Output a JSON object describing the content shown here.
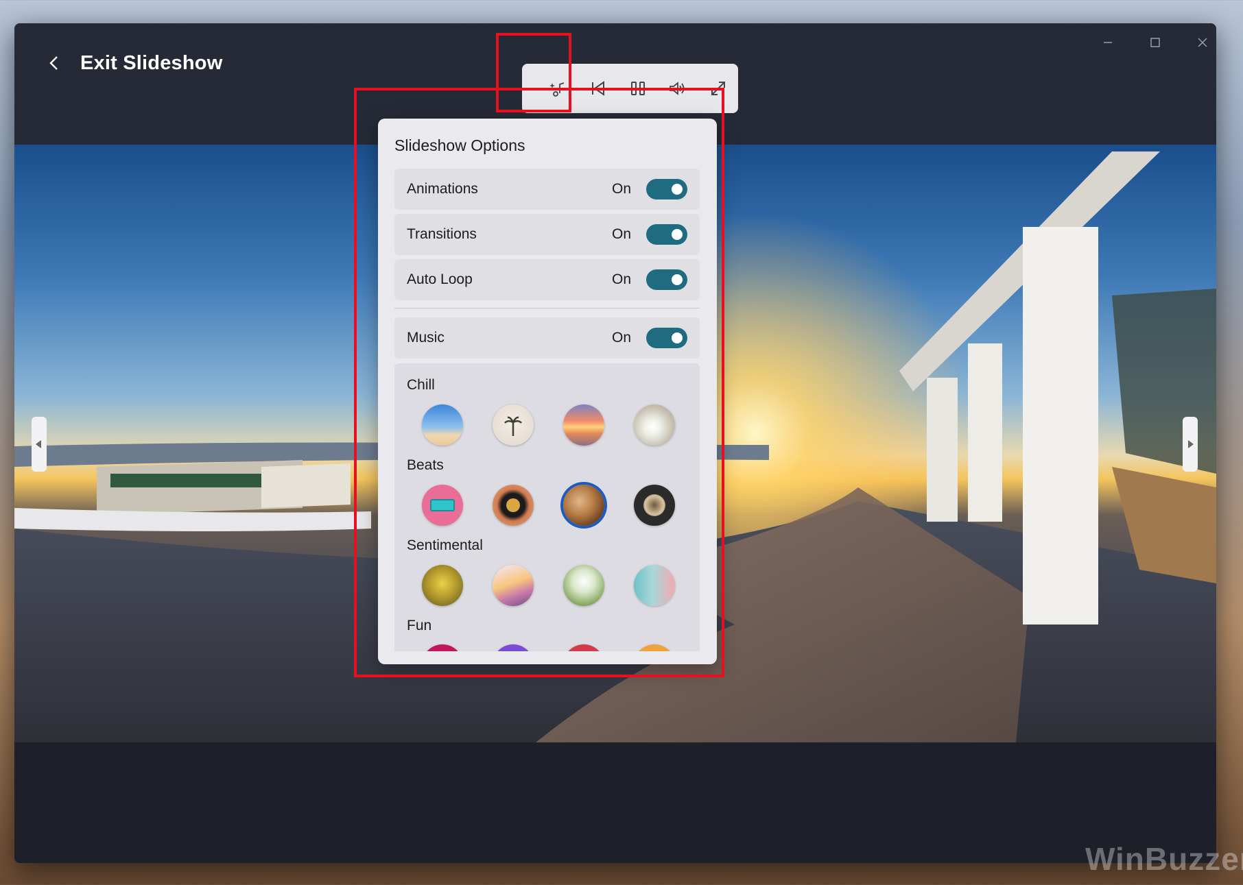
{
  "header": {
    "back_label": "Exit Slideshow"
  },
  "toolbar": {
    "buttons": [
      {
        "name": "music-note-sparkle-icon"
      },
      {
        "name": "previous-icon"
      },
      {
        "name": "pause-icon"
      },
      {
        "name": "volume-icon"
      },
      {
        "name": "fullscreen-icon"
      }
    ]
  },
  "panel": {
    "title": "Slideshow Options",
    "options": [
      {
        "label": "Animations",
        "state": "On"
      },
      {
        "label": "Transitions",
        "state": "On"
      },
      {
        "label": "Auto Loop",
        "state": "On"
      },
      {
        "label": "Music",
        "state": "On"
      }
    ],
    "music_categories": [
      {
        "label": "Chill"
      },
      {
        "label": "Beats"
      },
      {
        "label": "Sentimental"
      },
      {
        "label": "Fun"
      }
    ]
  },
  "colors": {
    "accent": "#1f6b80",
    "highlight": "#e8101e",
    "selected_ring": "#1c5cc0"
  },
  "watermark": "WinBuzzer"
}
